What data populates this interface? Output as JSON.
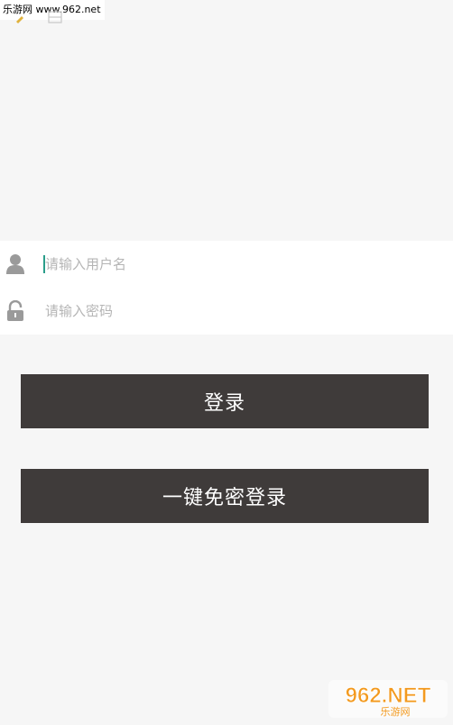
{
  "watermark": {
    "top_text": "乐游网 www.962.net",
    "logo_main": "962.NET",
    "logo_sub": "乐游网"
  },
  "form": {
    "username": {
      "placeholder": "请输入用户名",
      "value": "",
      "icon": "user-icon"
    },
    "password": {
      "placeholder": "请输入密码",
      "value": "",
      "icon": "lock-icon"
    }
  },
  "buttons": {
    "login_label": "登录",
    "quick_login_label": "一键免密登录"
  },
  "colors": {
    "background": "#f6f6f6",
    "panel": "#ffffff",
    "button": "#3f3b3a",
    "button_text": "#ffffff",
    "placeholder": "#b5b5b5",
    "cursor": "#2a9d8a",
    "icon": "#9a9a9a",
    "logo_orange": "#f39a1f"
  }
}
